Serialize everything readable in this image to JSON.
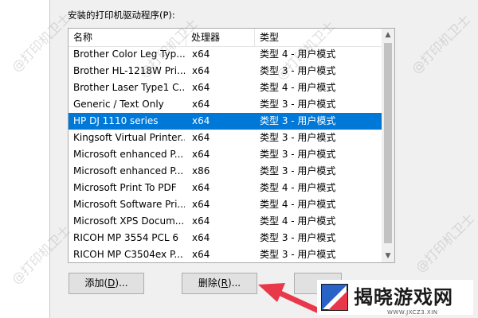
{
  "dialog": {
    "list_label": "安装的打印机驱动程序(P):"
  },
  "list": {
    "columns": [
      "名称",
      "处理器",
      "类型"
    ],
    "rows": [
      {
        "name": "Brother Color Leg Typ...",
        "processor": "x64",
        "type": "类型 4 - 用户模式"
      },
      {
        "name": "Brother HL-1218W Pri...",
        "processor": "x64",
        "type": "类型 3 - 用户模式"
      },
      {
        "name": "Brother Laser Type1 C...",
        "processor": "x64",
        "type": "类型 4 - 用户模式"
      },
      {
        "name": "Generic / Text Only",
        "processor": "x64",
        "type": "类型 3 - 用户模式"
      },
      {
        "name": "HP DJ 1110 series",
        "processor": "x64",
        "type": "类型 3 - 用户模式"
      },
      {
        "name": "Kingsoft Virtual Printer...",
        "processor": "x64",
        "type": "类型 3 - 用户模式"
      },
      {
        "name": "Microsoft enhanced P...",
        "processor": "x64",
        "type": "类型 3 - 用户模式"
      },
      {
        "name": "Microsoft enhanced P...",
        "processor": "x86",
        "type": "类型 3 - 用户模式"
      },
      {
        "name": "Microsoft Print To PDF",
        "processor": "x64",
        "type": "类型 4 - 用户模式"
      },
      {
        "name": "Microsoft Software Pri...",
        "processor": "x64",
        "type": "类型 4 - 用户模式"
      },
      {
        "name": "Microsoft XPS Docum...",
        "processor": "x64",
        "type": "类型 4 - 用户模式"
      },
      {
        "name": "RICOH MP 3554 PCL 6",
        "processor": "x64",
        "type": "类型 3 - 用户模式"
      },
      {
        "name": "RICOH MP C3504ex P...",
        "processor": "x64",
        "type": "类型 3 - 用户模式"
      }
    ],
    "selected_index": 4
  },
  "buttons": {
    "add_label": "添加(",
    "add_key": "D",
    "add_suffix": ")...",
    "delete_label": "删除(",
    "delete_key": "R",
    "delete_suffix": ")..."
  },
  "watermark": {
    "text": "@打印机卫士"
  },
  "logo": {
    "text": "揭晓游戏网",
    "url": "WWW.JXCZ3.XIN"
  },
  "colors": {
    "selection": "#0078d7",
    "arrow": "#e8384a"
  }
}
